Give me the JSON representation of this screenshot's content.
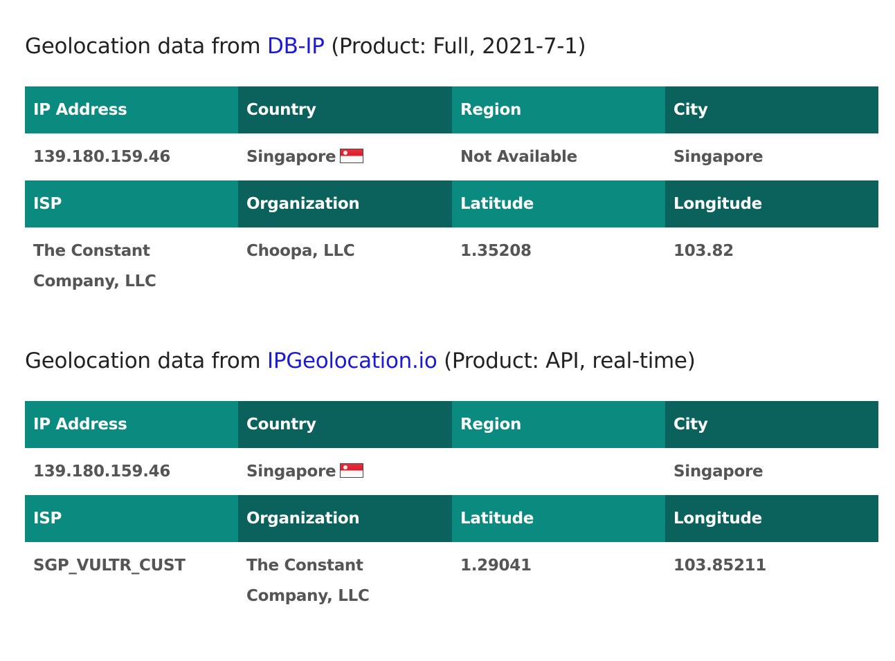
{
  "sections": [
    {
      "heading_prefix": "Geolocation data from ",
      "source_link": "DB-IP",
      "heading_suffix": " (Product: Full, 2021-7-1)",
      "headers_row1": [
        "IP Address",
        "Country",
        "Region",
        "City"
      ],
      "values_row1": {
        "ip": "139.180.159.46",
        "country": "Singapore",
        "region": "Not Available",
        "city": "Singapore"
      },
      "headers_row2": [
        "ISP",
        "Organization",
        "Latitude",
        "Longitude"
      ],
      "values_row2": {
        "isp": "The Constant Company, LLC",
        "organization": "Choopa, LLC",
        "latitude": "1.35208",
        "longitude": "103.82"
      }
    },
    {
      "heading_prefix": "Geolocation data from ",
      "source_link": "IPGeolocation.io",
      "heading_suffix": " (Product: API, real-time)",
      "headers_row1": [
        "IP Address",
        "Country",
        "Region",
        "City"
      ],
      "values_row1": {
        "ip": "139.180.159.46",
        "country": "Singapore",
        "region": "",
        "city": "Singapore"
      },
      "headers_row2": [
        "ISP",
        "Organization",
        "Latitude",
        "Longitude"
      ],
      "values_row2": {
        "isp": "SGP_VULTR_CUST",
        "organization": "The Constant Company, LLC",
        "latitude": "1.29041",
        "longitude": "103.85211"
      }
    }
  ],
  "flag_icon": "singapore-flag-icon",
  "colors": {
    "header_teal": "#0b8a80",
    "header_dark_teal": "#0b625d",
    "link_blue": "#1b1bd6",
    "value_gray": "#555555"
  }
}
